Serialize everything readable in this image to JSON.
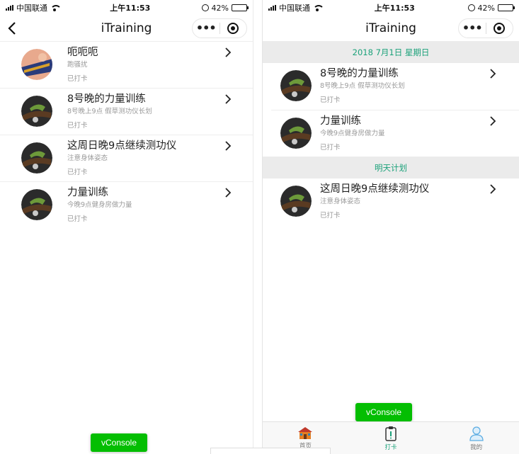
{
  "status_bar": {
    "carrier": "中国联通",
    "time": "上午11:53",
    "battery": "42%",
    "battery_level": 0.42
  },
  "nav": {
    "title": "iTraining"
  },
  "left_list": [
    {
      "title": "呃呃呃",
      "subtitle": "跑骚扰",
      "status": "已打卡"
    },
    {
      "title": "8号晚的力量训练",
      "subtitle": "8号晚上9点 假草测功仪长划",
      "status": "已打卡"
    },
    {
      "title": "这周日晚9点继续测功仪",
      "subtitle": "注意身体姿态",
      "status": "已打卡"
    },
    {
      "title": "力量训练",
      "subtitle": "今晚9点健身房做力量",
      "status": "已打卡"
    }
  ],
  "right_sections": [
    {
      "header": "2018 7月1日 星期日",
      "items": [
        {
          "title": "8号晚的力量训练",
          "subtitle": "8号晚上9点 假草测功仪长划",
          "status": "已打卡"
        },
        {
          "title": "力量训练",
          "subtitle": "今晚9点健身房做力量",
          "status": "已打卡"
        }
      ]
    },
    {
      "header": "明天计划",
      "items": [
        {
          "title": "这周日晚9点继续测功仪",
          "subtitle": "注意身体姿态",
          "status": "已打卡"
        }
      ]
    }
  ],
  "vconsole": {
    "label": "vConsole"
  },
  "tabs": [
    {
      "label": "首页",
      "icon": "house-icon"
    },
    {
      "label": "打卡",
      "icon": "clipboard-icon"
    },
    {
      "label": "我的",
      "icon": "user-icon"
    }
  ],
  "colors": {
    "accent": "#1aa179",
    "vconsole_green": "#04be02",
    "section_bg": "#ebebeb"
  }
}
